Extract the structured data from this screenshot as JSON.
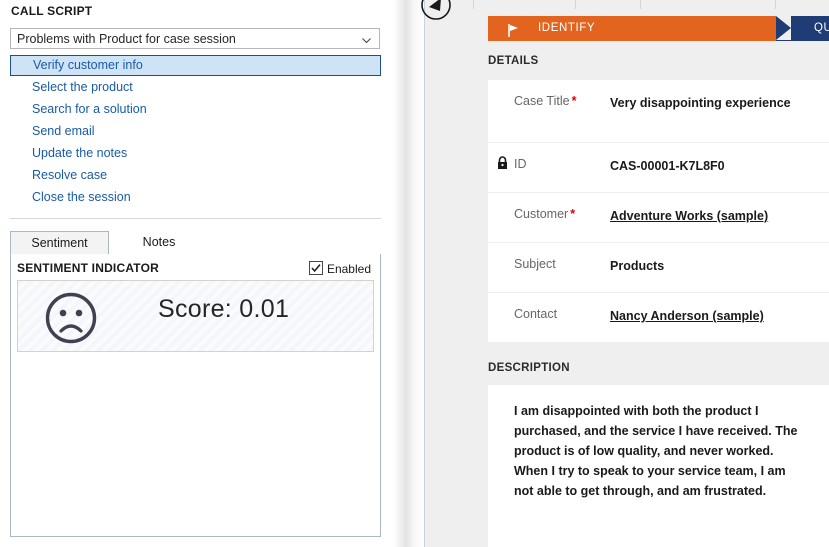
{
  "call_script": {
    "heading": "CALL SCRIPT",
    "selected_script": "Problems with Product for case session",
    "chevron_icon": "chevron-down-icon",
    "steps": [
      {
        "label": "Verify customer info",
        "selected": true
      },
      {
        "label": "Select the product",
        "selected": false
      },
      {
        "label": "Search for a solution",
        "selected": false
      },
      {
        "label": "Send email",
        "selected": false
      },
      {
        "label": "Update the notes",
        "selected": false
      },
      {
        "label": "Resolve case",
        "selected": false
      },
      {
        "label": "Close the session",
        "selected": false
      }
    ]
  },
  "tabs": {
    "items": [
      {
        "label": "Sentiment",
        "active": true
      },
      {
        "label": "Notes",
        "active": false
      }
    ]
  },
  "sentiment": {
    "heading": "SENTIMENT INDICATOR",
    "enabled_label": "Enabled",
    "enabled_checked": true,
    "face_icon": "sad-face-icon",
    "score_text": "Score: 0.01",
    "score_value": 0.01
  },
  "right": {
    "refresh_icon": "refresh-back-icon",
    "flow": {
      "flag_icon": "flag-icon",
      "stages": [
        {
          "label": "IDENTIFY",
          "color": "#E2641F",
          "active": true
        },
        {
          "label": "QUALIFY",
          "color": "#1F3C74",
          "active": false
        }
      ]
    },
    "details": {
      "heading": "DETAILS",
      "fields": [
        {
          "label": "Case Title",
          "required": true,
          "locked": false,
          "value": "Very disappointing experience",
          "link": false
        },
        {
          "label": "ID",
          "required": false,
          "locked": true,
          "lock_icon": "lock-icon",
          "value": "CAS-00001-K7L8F0",
          "link": false
        },
        {
          "label": "Customer",
          "required": true,
          "locked": false,
          "value": "Adventure Works (sample)",
          "link": true
        },
        {
          "label": "Subject",
          "required": false,
          "locked": false,
          "value": "Products",
          "link": false
        },
        {
          "label": "Contact",
          "required": false,
          "locked": false,
          "value": "Nancy Anderson (sample)",
          "link": true
        }
      ]
    },
    "description": {
      "heading": "DESCRIPTION",
      "text": "I am disappointed with both the product I purchased, and the service I have received. The product is of low quality, and never worked. When I try to speak to your service team, I am not able to get through, and am frustrated."
    }
  },
  "colors": {
    "accent_orange": "#E2641F",
    "accent_navy": "#1F3C74",
    "link_blue": "#1A5BA6",
    "required_red": "#E00000",
    "panel_gray": "#EFEFEF"
  }
}
